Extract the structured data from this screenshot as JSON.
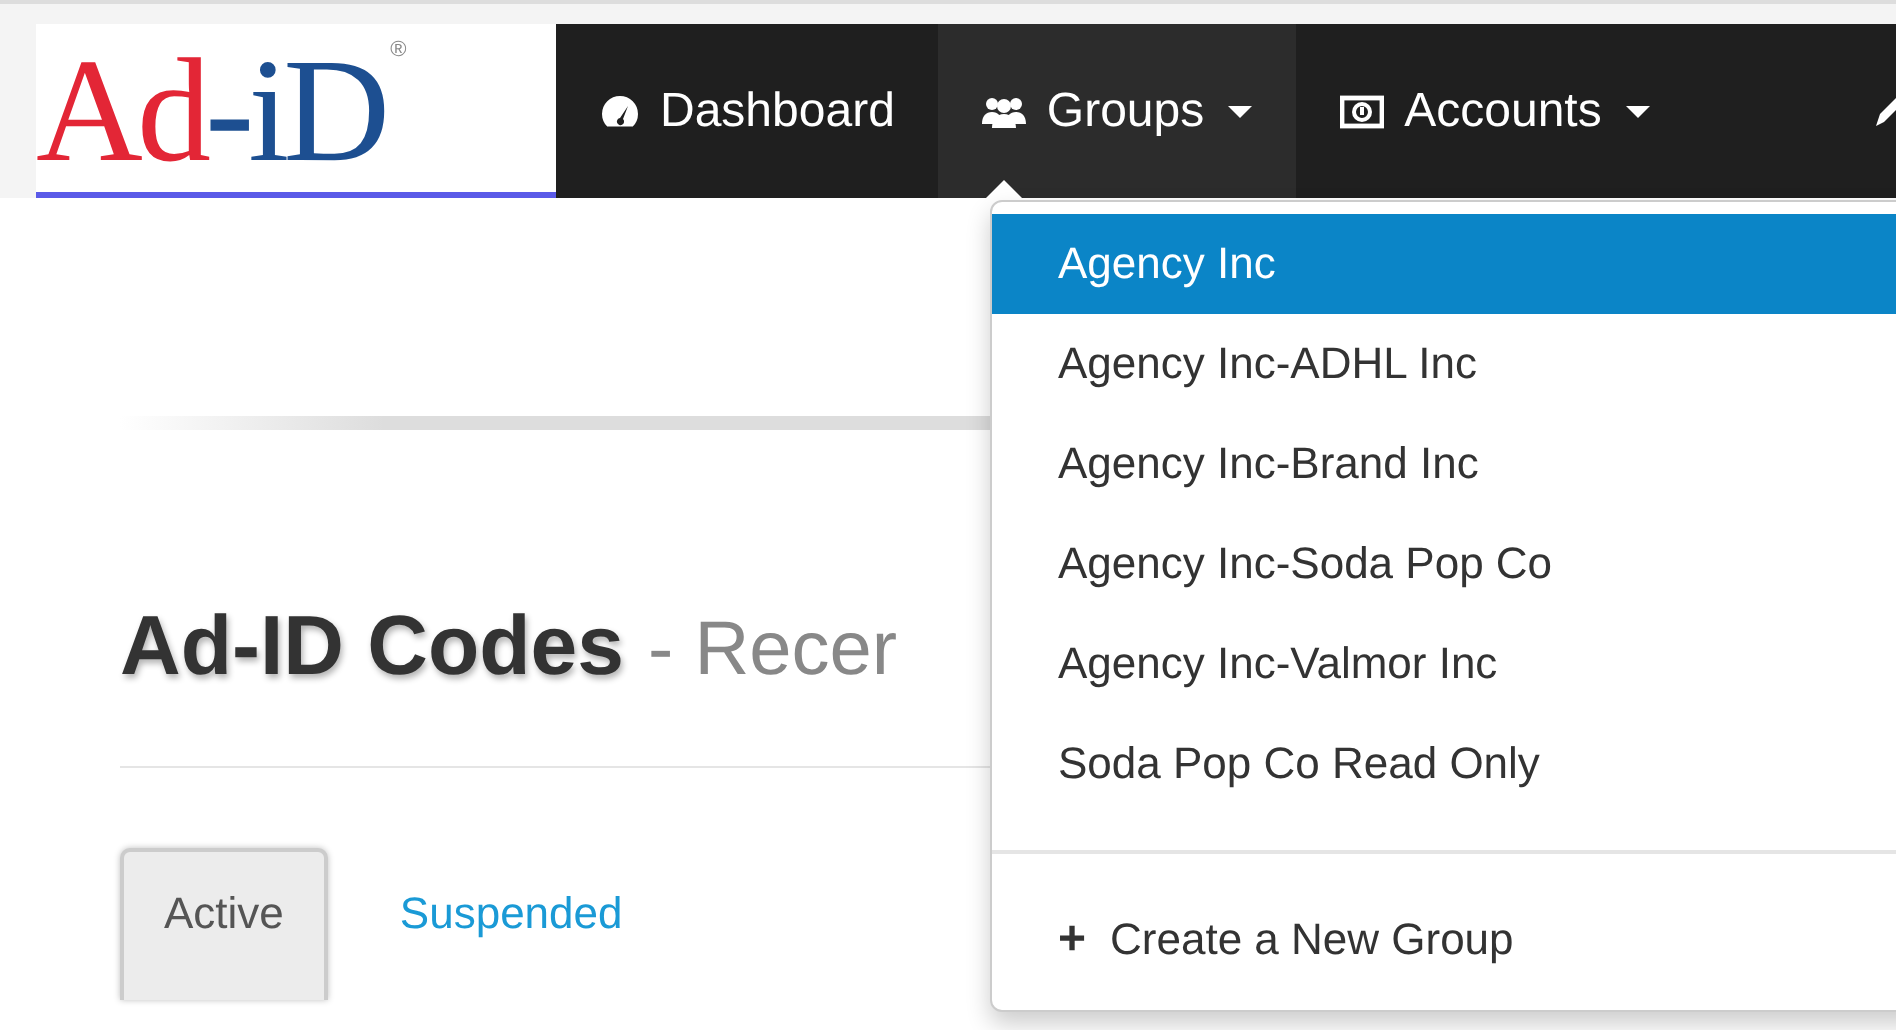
{
  "logo": {
    "parts": [
      {
        "text": "Ad",
        "color": "#e32636"
      },
      {
        "text": "-iD",
        "color": "#1d4f91"
      },
      {
        "text": "®",
        "color": "#888888"
      }
    ]
  },
  "nav": {
    "items": [
      {
        "label": "Dashboard",
        "caret": false,
        "open": false
      },
      {
        "label": "Groups",
        "caret": true,
        "open": true
      },
      {
        "label": "Accounts",
        "caret": true,
        "open": false
      }
    ]
  },
  "groups_menu": {
    "items": [
      {
        "label": "Agency Inc",
        "selected": true
      },
      {
        "label": "Agency Inc-ADHL Inc",
        "selected": false
      },
      {
        "label": "Agency Inc-Brand Inc",
        "selected": false
      },
      {
        "label": "Agency Inc-Soda Pop Co",
        "selected": false
      },
      {
        "label": "Agency Inc-Valmor Inc",
        "selected": false
      },
      {
        "label": "Soda Pop Co Read Only",
        "selected": false
      }
    ],
    "action": {
      "icon": "+",
      "label": "Create a New Group"
    }
  },
  "heading": {
    "title": "Ad-ID Codes",
    "subtitle": "- Recer"
  },
  "tabs": [
    {
      "label": "Active",
      "selected": true
    },
    {
      "label": "Suspended",
      "selected": false
    }
  ]
}
